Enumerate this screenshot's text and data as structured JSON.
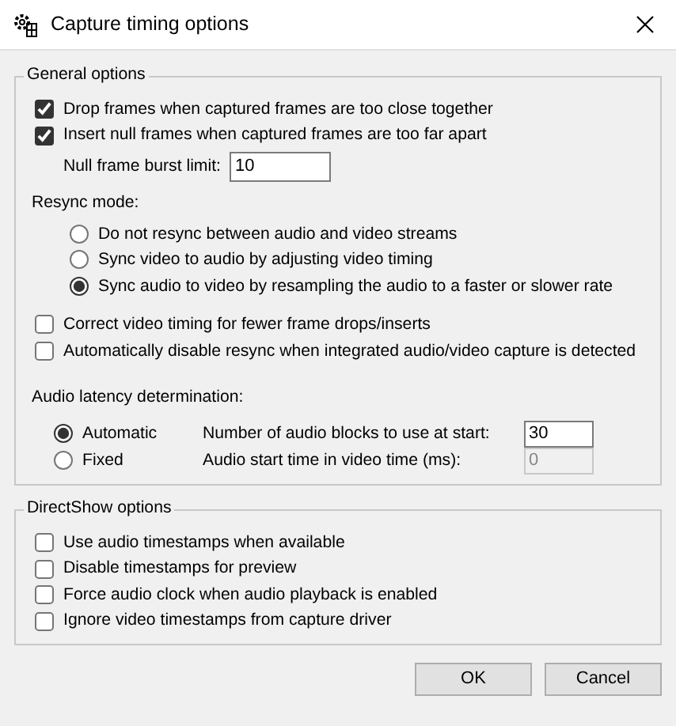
{
  "window": {
    "title": "Capture timing options"
  },
  "general_options": {
    "title": "General options",
    "frame_options": [
      {
        "label": "Drop frames when captured frames are too close together",
        "checked": true
      },
      {
        "label": "Insert null frames when captured frames are too far apart",
        "checked": true
      }
    ],
    "null_frame_burst_limit": {
      "label": "Null frame burst limit:",
      "value": "10"
    },
    "resync_mode": {
      "label": "Resync mode:",
      "options": [
        {
          "label": "Do not resync between audio and video streams",
          "selected": false
        },
        {
          "label": "Sync video to audio by adjusting video timing",
          "selected": false
        },
        {
          "label": "Sync audio to video by resampling the audio to a faster or slower rate",
          "selected": true
        }
      ]
    },
    "options": [
      {
        "label": "Correct video timing for fewer frame drops/inserts",
        "checked": false
      },
      {
        "label": "Automatically disable resync when integrated audio/video capture is detected",
        "checked": false
      }
    ],
    "audio_latency": {
      "label": "Audio latency determination:",
      "modes": [
        {
          "label": "Automatic",
          "selected": true
        },
        {
          "label": "Fixed",
          "selected": false
        }
      ],
      "fields": [
        {
          "label": "Number of audio blocks to use at start:",
          "value": "30",
          "disabled": false
        },
        {
          "label": "Audio start time in video time (ms):",
          "value": "0",
          "disabled": true
        }
      ]
    }
  },
  "directshow_options": {
    "title": "DirectShow options",
    "options": [
      {
        "label": "Use audio timestamps when available",
        "checked": false
      },
      {
        "label": "Disable timestamps for preview",
        "checked": false
      },
      {
        "label": "Force audio clock when audio playback is enabled",
        "checked": false
      },
      {
        "label": "Ignore video timestamps from capture driver",
        "checked": false
      }
    ]
  },
  "buttons": [
    {
      "label": "OK"
    },
    {
      "label": "Cancel"
    }
  ]
}
